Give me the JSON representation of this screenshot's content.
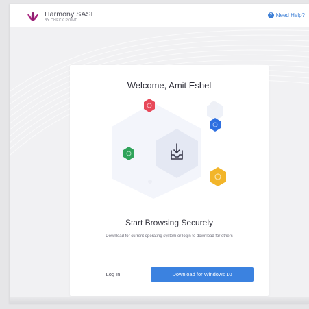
{
  "header": {
    "brand": "Harmony SASE",
    "brand_sub": "BY CHECK POINT",
    "help_label": "Need Help?"
  },
  "card": {
    "title": "Welcome, Amit Eshel",
    "subtitle": "Start Browsing Securely",
    "description": "Download for current operating system or login to download for others",
    "login_label": "Log In",
    "download_label": "Download for Windows 10"
  },
  "colors": {
    "accent": "#3b82e0",
    "brand_magenta": "#8e1e6e",
    "hex_red": "#e8495a",
    "hex_blue": "#2e6fe0",
    "hex_green": "#2fa35a",
    "hex_yellow": "#f2b52a"
  },
  "icons": [
    "harmony-logo-icon",
    "help-icon",
    "download-box-icon"
  ]
}
